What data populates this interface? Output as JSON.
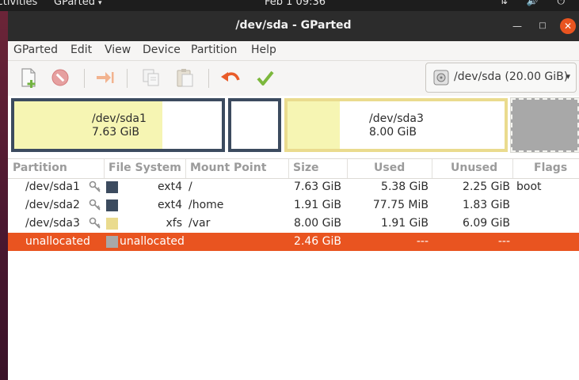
{
  "desktop": {
    "activities": "Activities",
    "app_menu": "GParted",
    "app_menu_arrow": "▾",
    "clock": "Feb 1  09:36",
    "system_icons": "⇅ 🔊 ⏻"
  },
  "window": {
    "title": "/dev/sda - GParted",
    "buttons": {
      "minimize": "—",
      "maximize": "□",
      "close": "✕"
    }
  },
  "menubar": [
    "GParted",
    "Edit",
    "View",
    "Device",
    "Partition",
    "Help"
  ],
  "toolbar": {
    "icons": [
      "new-partition-icon",
      "delete-icon",
      "resize-move-icon",
      "copy-icon",
      "paste-icon",
      "undo-icon",
      "apply-icon"
    ],
    "device": {
      "label": "/dev/sda (20.00 GiB)",
      "caret": "▾"
    }
  },
  "partition_map": [
    {
      "name": "/dev/sda1",
      "size": "7.63 GiB",
      "used_fraction": 0.705
    },
    {
      "name": "",
      "size": "",
      "used_fraction": 0.0
    },
    {
      "name": "/dev/sda3",
      "size": "8.00 GiB",
      "used_fraction": 0.24
    },
    {
      "name": "",
      "size": ""
    }
  ],
  "table": {
    "headers": [
      "Partition",
      "File System",
      "Mount Point",
      "Size",
      "Used",
      "Unused",
      "Flags"
    ],
    "rows": [
      {
        "partition": "/dev/sda1",
        "fs": "ext4",
        "fs_color": "#3c4b5f",
        "mount": "/",
        "size": "7.63 GiB",
        "used": "5.38 GiB",
        "unused": "2.25 GiB",
        "flags": "boot"
      },
      {
        "partition": "/dev/sda2",
        "fs": "ext4",
        "fs_color": "#3c4b5f",
        "mount": "/home",
        "size": "1.91 GiB",
        "used": "77.75 MiB",
        "unused": "1.83 GiB",
        "flags": ""
      },
      {
        "partition": "/dev/sda3",
        "fs": "xfs",
        "fs_color": "#eadb8e",
        "mount": "/var",
        "size": "8.00 GiB",
        "used": "1.91 GiB",
        "unused": "6.09 GiB",
        "flags": ""
      },
      {
        "partition": "unallocated",
        "fs": "unallocated",
        "fs_color": "#a8a8a8",
        "mount": "",
        "size": "2.46 GiB",
        "used": "---",
        "unused": "---",
        "flags": ""
      }
    ]
  },
  "colors": {
    "accent": "#e95420",
    "ext4": "#3c4b5f",
    "xfs": "#eadb8e",
    "used_fill": "#f6f5b3",
    "unallocated": "#a8a8a8"
  }
}
